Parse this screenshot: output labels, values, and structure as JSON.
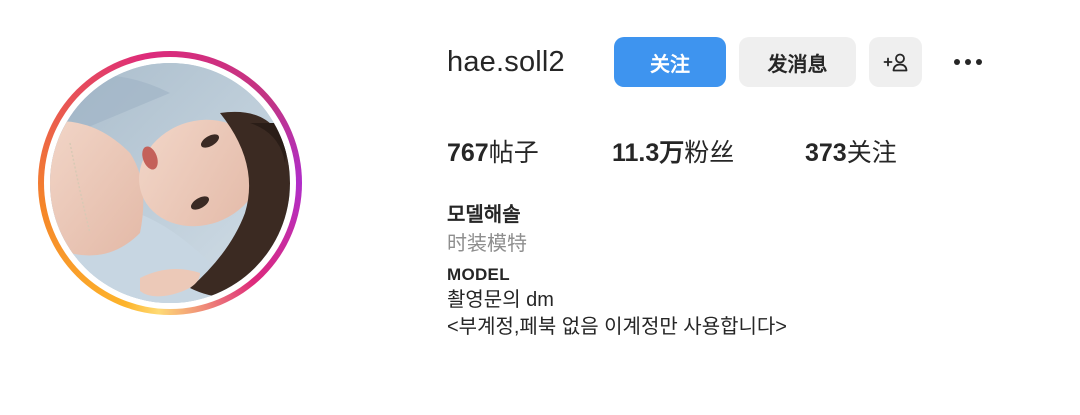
{
  "profile": {
    "username": "hae.soll2",
    "buttons": {
      "follow_label": "关注",
      "message_label": "发消息",
      "suggest_icon": "add-person-icon",
      "more_icon": "more-horizontal-icon"
    },
    "stats": {
      "posts_count": "767",
      "posts_label": "帖子",
      "followers_count": "11.3万",
      "followers_label": "粉丝",
      "following_count": "373",
      "following_label": "关注"
    },
    "bio": {
      "name": "모델해솔",
      "category": "时装模特",
      "lines": [
        "MODEL",
        "촬영문의 dm",
        "<부계정,페북 없음 이계정만 사용합니다>"
      ]
    },
    "colors": {
      "follow_button": "#3e94ef",
      "secondary_button": "#efefef",
      "text": "#262626",
      "muted_text": "#8e8e8e",
      "story_ring": [
        "#fdb42b",
        "#f58529",
        "#dd2a7b",
        "#c13584",
        "#b02dc9"
      ]
    }
  }
}
